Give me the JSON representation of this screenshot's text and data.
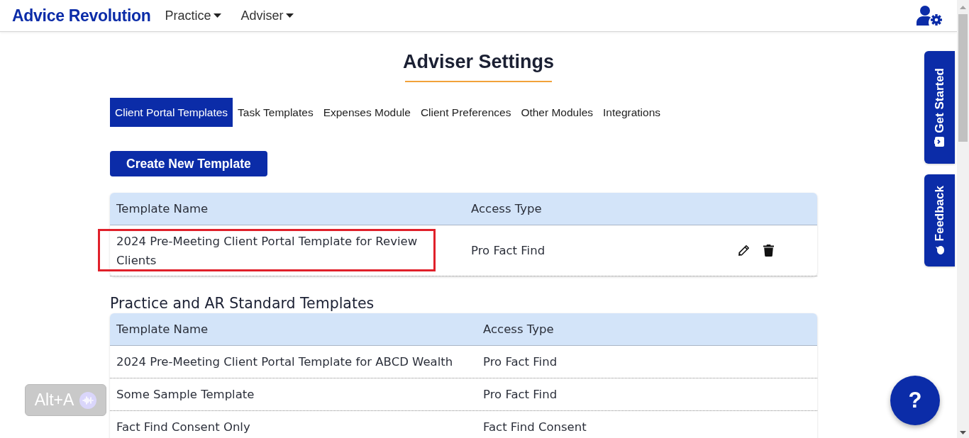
{
  "nav": {
    "logo": "Advice Revolution",
    "menus": [
      {
        "label": "Practice"
      },
      {
        "label": "Adviser"
      }
    ]
  },
  "header": {
    "title": "Adviser Settings"
  },
  "tabs": [
    {
      "label": "Client Portal Templates",
      "selected": true
    },
    {
      "label": "Task Templates",
      "selected": false
    },
    {
      "label": "Expenses Module",
      "selected": false
    },
    {
      "label": "Client Preferences",
      "selected": false
    },
    {
      "label": "Other Modules",
      "selected": false
    },
    {
      "label": "Integrations",
      "selected": false
    }
  ],
  "create_button": {
    "label": "Create New Template"
  },
  "adviser_templates": {
    "columns": [
      "Template Name",
      "Access Type"
    ],
    "rows": [
      {
        "name": "2024 Pre-Meeting Client Portal Template for Review Clients",
        "access_type": "Pro Fact Find",
        "highlighted": true,
        "editable": true
      }
    ]
  },
  "standard_templates": {
    "title": "Practice and AR Standard Templates",
    "columns": [
      "Template Name",
      "Access Type"
    ],
    "rows": [
      {
        "name": "2024 Pre-Meeting Client Portal Template for ABCD Wealth",
        "access_type": "Pro Fact Find"
      },
      {
        "name": "Some Sample Template",
        "access_type": "Pro Fact Find"
      },
      {
        "name": "Fact Find Consent Only",
        "access_type": "Fact Find Consent"
      }
    ]
  },
  "side_tabs": [
    {
      "label": "Get Started"
    },
    {
      "label": "Feedback"
    }
  ],
  "accessibility_button": {
    "label": "Alt+A"
  },
  "help_button": {
    "label": "?"
  }
}
